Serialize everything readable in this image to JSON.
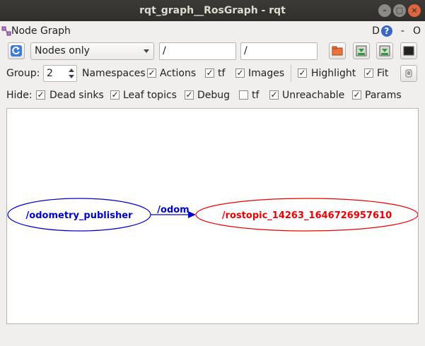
{
  "window": {
    "title": "rqt_graph__RosGraph - rqt"
  },
  "plugin": {
    "title": "Node Graph",
    "help_letter": "D",
    "right_dash": "-",
    "right_o": "O"
  },
  "toolbar": {
    "filter_mode": "Nodes only",
    "node_filter": "/",
    "topic_filter": "/"
  },
  "options": {
    "group_label": "Group:",
    "group_value": "2",
    "namespaces_label": "Namespaces",
    "actions_label": "Actions",
    "tf_label": "tf",
    "images_label": "Images",
    "highlight_label": "Highlight",
    "fit_label": "Fit",
    "namespaces_checked": true,
    "actions_checked": true,
    "tf_checked": true,
    "images_checked": true,
    "highlight_checked": true,
    "fit_checked": true
  },
  "hide": {
    "label": "Hide:",
    "dead_sinks_label": "Dead sinks",
    "leaf_topics_label": "Leaf topics",
    "debug_label": "Debug",
    "tf_label": "tf",
    "unreachable_label": "Unreachable",
    "params_label": "Params",
    "dead_sinks_checked": true,
    "leaf_topics_checked": true,
    "debug_checked": true,
    "tf_checked": false,
    "unreachable_checked": true,
    "params_checked": true
  },
  "graph": {
    "source_node": "/odometry_publisher",
    "target_node": "/rostopic_14263_1646726957610",
    "edge_label": "/odom",
    "source_color": "#0000cc",
    "target_color": "#ee0000"
  },
  "colors": {
    "titlebar": "#3c3b37",
    "window_bg": "#f0efed",
    "close_button": "#e0643b"
  }
}
